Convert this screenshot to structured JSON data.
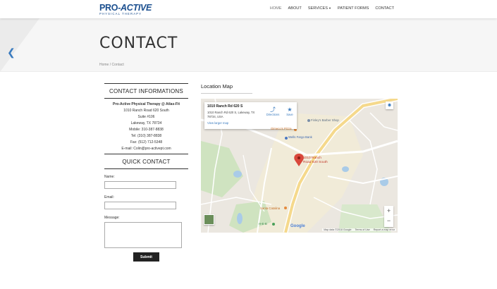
{
  "logo": {
    "main_a": "PRO",
    "main_b": "-ACTIVE",
    "sub": "PHYSICAL THERAPY"
  },
  "nav": {
    "home": "HOME",
    "about": "ABOUT",
    "services": "SERVICES",
    "patient_forms": "PATIENT FORMS",
    "contact": "CONTACT"
  },
  "hero": {
    "title": "CONTACT",
    "breadcrumb": "Home / Contact",
    "back_icon": "chevron-left-icon"
  },
  "contact_info": {
    "heading": "CONTACT INFORMATIONS",
    "business": "Pro-Active Physical Therapy @ Atlas-Fit",
    "address1": "1010 Ranch Road 620 South",
    "address2": "Suite #106",
    "city": "Lakeway, TX 78734",
    "mobile": "Mobile: 310-387-8838",
    "tel": "Tel: (310) 387-8838",
    "fax": "Fax: (512) 712-5348",
    "email": "E-mail: Colin@pro-activept.com"
  },
  "quick_contact": {
    "heading": "QUICK CONTACT",
    "name_label": "Name:",
    "email_label": "Email:",
    "message_label": "Message:",
    "submit": "Submit"
  },
  "map": {
    "title": "Location Map",
    "card_address": "1010 Ranch Rd 620 S",
    "card_full": "1010 Ranch Rd 620 S, Lakeway, TX 78734, USA",
    "directions": "Directions",
    "save": "Save",
    "larger": "View larger map",
    "pin_label_1": "1010 Ranch",
    "pin_label_2": "Road 620 South",
    "poi_barber": "Finley's Barber Shop",
    "poi_pizza": "Gimeco's Pizza",
    "poi_bank": "Wells Fargo Bank",
    "poi_santa": "Santa Catalina",
    "poi_hsb": "H-E-B",
    "google": "Google",
    "map_data": "Map data ©2018 Google",
    "terms": "Terms of Use",
    "report": "Report a map error",
    "zoom_in": "+",
    "zoom_out": "−"
  },
  "colors": {
    "brand": "#1b4f8f",
    "accent": "#3a7bbf",
    "pin": "#d9473b"
  }
}
